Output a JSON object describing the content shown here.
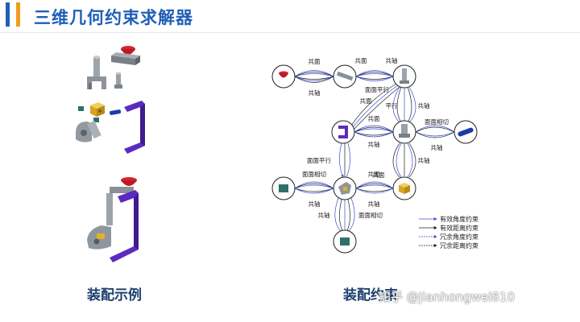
{
  "header": {
    "title": "三维几何约束求解器"
  },
  "captions": {
    "left": "装配示例",
    "right": "装配约束"
  },
  "watermark": "知乎 @Jianhongwei810",
  "graph": {
    "edges": [
      {
        "label_top": "共面",
        "label_bottom": "共轴"
      },
      {
        "label_top": "共面",
        "label_top2": "共轴"
      },
      {
        "label_top": "面面平行"
      },
      {
        "label_top": "共面",
        "label_mid": "平行"
      },
      {
        "label_top": "共轴"
      },
      {
        "label_top": "共面",
        "label_bottom": "共轴"
      },
      {
        "label_top": "面面相切",
        "label_bottom": "共轴"
      },
      {
        "label_top": "共轴",
        "label_bottom": "共面"
      },
      {
        "label_top": "面面平行"
      },
      {
        "label_top": "面面相切",
        "label_bottom": "共轴"
      },
      {
        "label_top": "共面",
        "label_bottom": "共轴"
      },
      {
        "label_top": "共轴"
      },
      {
        "label_top": "面面相切"
      }
    ]
  },
  "legend": {
    "items": [
      "有效角度约束",
      "有效距离约束",
      "冗余角度约束",
      "冗余距离约束"
    ]
  },
  "colors": {
    "title": "#1f5fb7",
    "accent_blue": "#1f5fb7",
    "accent_orange": "#f29a1f",
    "purple": "#5b2bbf",
    "red_knob": "#d9232e",
    "gold": "#e0b12a",
    "teal": "#2f6f6a",
    "navy": "#1f3aa8"
  }
}
